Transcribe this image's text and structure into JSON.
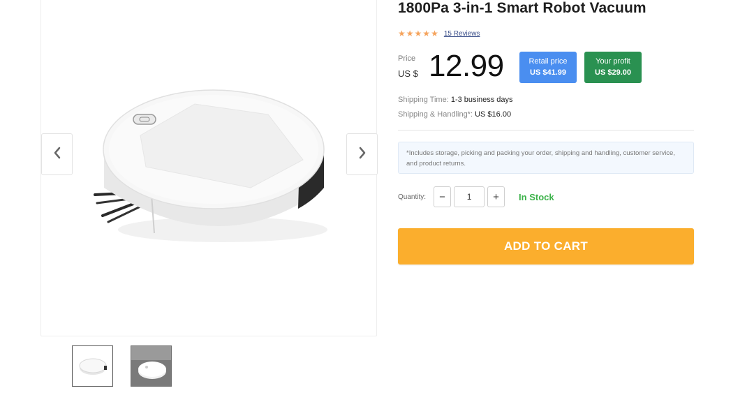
{
  "product": {
    "title": "1800Pa 3-in-1 Smart Robot Vacuum",
    "rating_stars": 5,
    "reviews_label": "15 Reviews",
    "images": [
      {
        "name": "robot-vacuum-white"
      },
      {
        "name": "robot-vacuum-on-floor"
      }
    ],
    "active_image_index": 0
  },
  "price": {
    "label": "Price",
    "currency": "US $",
    "value": "12.99",
    "retail_label": "Retail price",
    "retail_value": "US $41.99",
    "profit_label": "Your profit",
    "profit_value": "US $29.00"
  },
  "shipping": {
    "time_label": "Shipping Time:",
    "time_value": "1-3 business days",
    "handling_label": "Shipping & Handling*:",
    "handling_value": "US $16.00",
    "note": "*Includes storage, picking and packing your order, shipping and handling, customer service, and product returns."
  },
  "quantity": {
    "label": "Quantity:",
    "value": "1",
    "minus": "−",
    "plus": "+",
    "stock": "In Stock"
  },
  "cart": {
    "button_label": "ADD TO CART"
  },
  "colors": {
    "retail_badge": "#4a8ef0",
    "profit_badge": "#2a9151",
    "cart_button": "#fbae2d",
    "in_stock": "#3cb24a",
    "stars": "#f5a35c"
  },
  "icons": {
    "prev": "chevron-left-icon",
    "next": "chevron-right-icon",
    "star": "star-icon"
  }
}
